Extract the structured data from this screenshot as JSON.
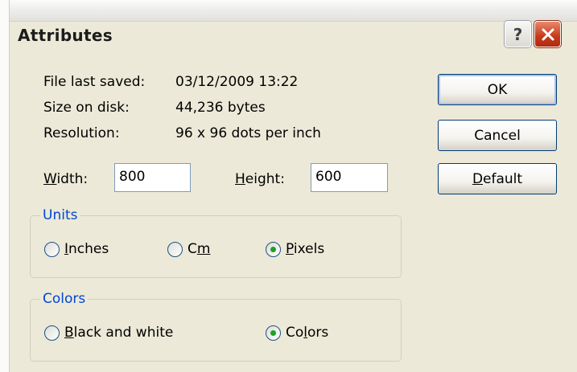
{
  "window": {
    "title": "Attributes"
  },
  "titlebar": {
    "help_label": "?",
    "close_label": "close"
  },
  "info": {
    "file_last_saved_label": "File last saved:",
    "file_last_saved_value": "03/12/2009 13:22",
    "size_on_disk_label": "Size on disk:",
    "size_on_disk_value": "44,236 bytes",
    "resolution_label": "Resolution:",
    "resolution_value": "96 x 96 dots per inch"
  },
  "dimensions": {
    "width_label_accel": "W",
    "width_label_rest": "idth:",
    "width_value": "800",
    "height_label_accel": "H",
    "height_label_rest": "eight:",
    "height_value": "600"
  },
  "units": {
    "group_label": "Units",
    "options": [
      {
        "accel": "I",
        "rest": "nches",
        "pre": "",
        "checked": false
      },
      {
        "pre": "C",
        "accel": "m",
        "rest": "",
        "checked": false
      },
      {
        "accel": "P",
        "rest": "ixels",
        "pre": "",
        "checked": true
      }
    ]
  },
  "colors": {
    "group_label": "Colors",
    "options": [
      {
        "accel": "B",
        "rest": "lack and white",
        "pre": "",
        "checked": false
      },
      {
        "pre": "Co",
        "accel": "l",
        "rest": "ors",
        "checked": true
      }
    ]
  },
  "buttons": {
    "ok": "OK",
    "cancel": "Cancel",
    "default_accel": "D",
    "default_rest": "efault"
  },
  "palette": {
    "accent": "#0046d5",
    "close_red": "#c5391a",
    "face": "#ece9d8"
  }
}
